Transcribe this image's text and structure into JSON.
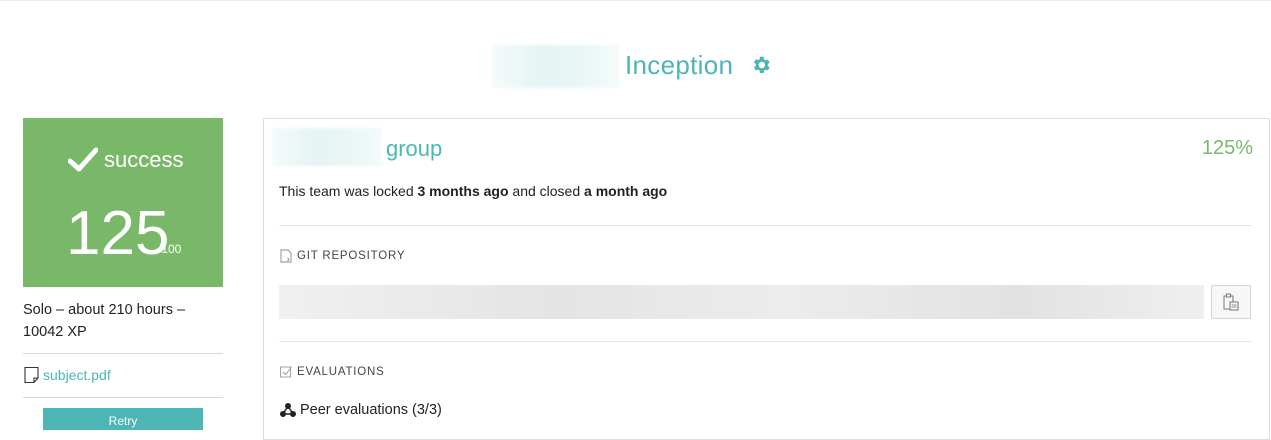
{
  "project": {
    "title": "Inception",
    "settings_icon": "gear-icon"
  },
  "status": {
    "label": "success",
    "score": "125",
    "max": "/100",
    "color": "#79b869"
  },
  "info": {
    "details_line1": "Solo – about 210 hours –",
    "details_line2": "10042 XP",
    "subject_link": "subject.pdf",
    "retry_label": "Retry"
  },
  "team": {
    "group_suffix": "group",
    "percent": "125%",
    "locked_prefix": "This team was locked ",
    "locked_time": "3 months ago",
    "closed_prefix": " and closed ",
    "closed_time": "a month ago"
  },
  "git": {
    "heading": "GIT REPOSITORY"
  },
  "evaluations": {
    "heading": "EVALUATIONS",
    "peer_label": "Peer evaluations (3/3)"
  },
  "colors": {
    "accent": "#4db6b5",
    "success": "#79b869"
  }
}
